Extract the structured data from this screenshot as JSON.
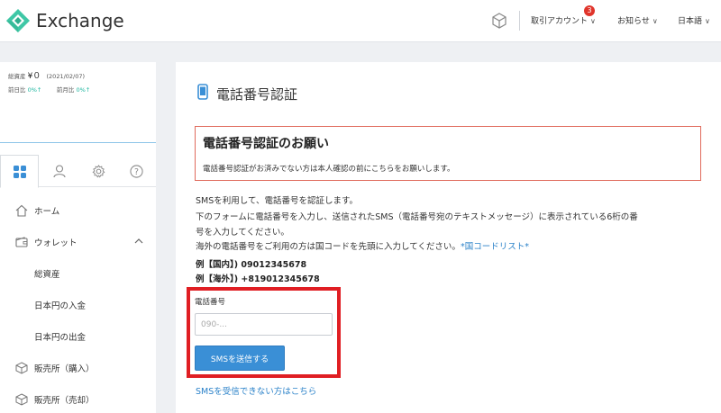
{
  "header": {
    "brand": "Exchange",
    "menu": [
      {
        "label": "取引アカウント",
        "badge": "3"
      },
      {
        "label": "お知らせ"
      },
      {
        "label": "日本語"
      }
    ]
  },
  "sidebar": {
    "account": {
      "total_label": "総資産",
      "total_value": "¥０",
      "date": "(2021/02/07)",
      "day_label": "前日比",
      "day_value": "0%↑",
      "month_label": "前月比",
      "month_value": "0%↑"
    },
    "tabs": [
      "dashboard-icon",
      "user-icon",
      "gear-icon",
      "help-icon"
    ],
    "items": [
      {
        "label": "ホーム",
        "icon": "home-icon"
      },
      {
        "label": "ウォレット",
        "icon": "wallet-icon"
      },
      {
        "label": "総資産"
      },
      {
        "label": "日本円の入金"
      },
      {
        "label": "日本円の出金"
      },
      {
        "label": "販売所（購入）",
        "icon": "cube-icon"
      },
      {
        "label": "販売所（売却）",
        "icon": "cube-icon"
      }
    ]
  },
  "main": {
    "title": "電話番号認証",
    "notice": {
      "title": "電話番号認証のお願い",
      "text": "電話番号認証がお済みでない方は本人確認の前にこちらをお願いします。"
    },
    "lines": [
      "SMSを利用して、電話番号を認証します。",
      "下のフォームに電話番号を入力し、送信されたSMS（電話番号宛のテキストメッセージ）に表示されている6桁の番",
      "号を入力してください。",
      "海外の電話番号をご利用の方は国コードを先頭に入力してください。"
    ],
    "country_code_link": "*国コードリスト*",
    "examples": [
      "例【国内】) 09012345678",
      "例【海外】) +819012345678"
    ],
    "phone_label": "電話番号",
    "phone_placeholder": "090-...",
    "phone_value": "",
    "send_button": "SMSを送信する",
    "help_link": "SMSを受信できない方はこちら"
  },
  "colors": {
    "accent": "#3a8fd6",
    "teal": "#1fb6a0",
    "notice_border": "#e06b5c",
    "highlight": "#e01e23",
    "badge": "#e0352b"
  }
}
